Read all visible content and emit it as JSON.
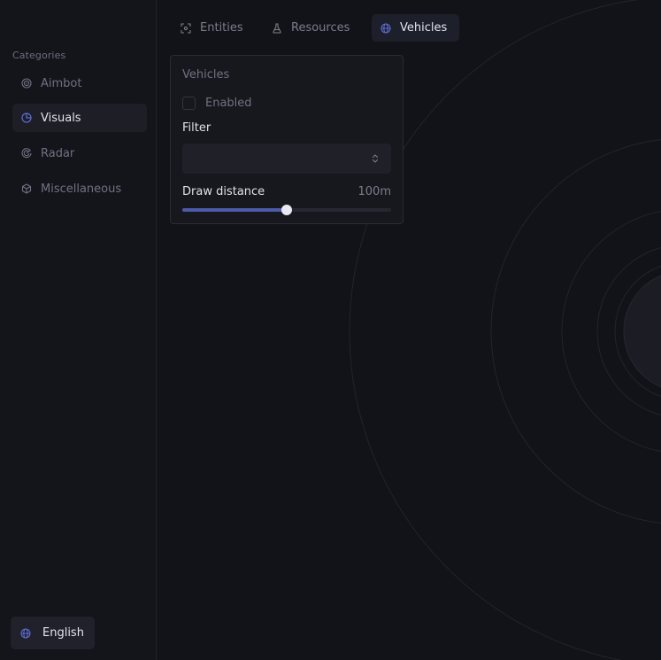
{
  "sidebar": {
    "heading": "Categories",
    "items": [
      {
        "label": "Aimbot",
        "icon": "target-icon",
        "active": false
      },
      {
        "label": "Visuals",
        "icon": "pie-chart-icon",
        "active": true
      },
      {
        "label": "Radar",
        "icon": "radar-icon",
        "active": false
      },
      {
        "label": "Miscellaneous",
        "icon": "cube-icon",
        "active": false
      }
    ],
    "language": {
      "label": "English",
      "icon": "globe-icon"
    }
  },
  "tabs": [
    {
      "label": "Entities",
      "icon": "scan-icon",
      "active": false
    },
    {
      "label": "Resources",
      "icon": "flask-icon",
      "active": false
    },
    {
      "label": "Vehicles",
      "icon": "globe-icon",
      "active": true
    }
  ],
  "panel": {
    "title": "Vehicles",
    "enabled_label": "Enabled",
    "enabled": false,
    "filter_label": "Filter",
    "filter_value": "",
    "distance_label": "Draw distance",
    "distance_value": "100m",
    "distance_fraction": 0.5
  },
  "colors": {
    "background": "#121318",
    "accent": "#4d5aa8",
    "text_primary": "#e4e5ee",
    "text_muted": "#6f7180"
  }
}
